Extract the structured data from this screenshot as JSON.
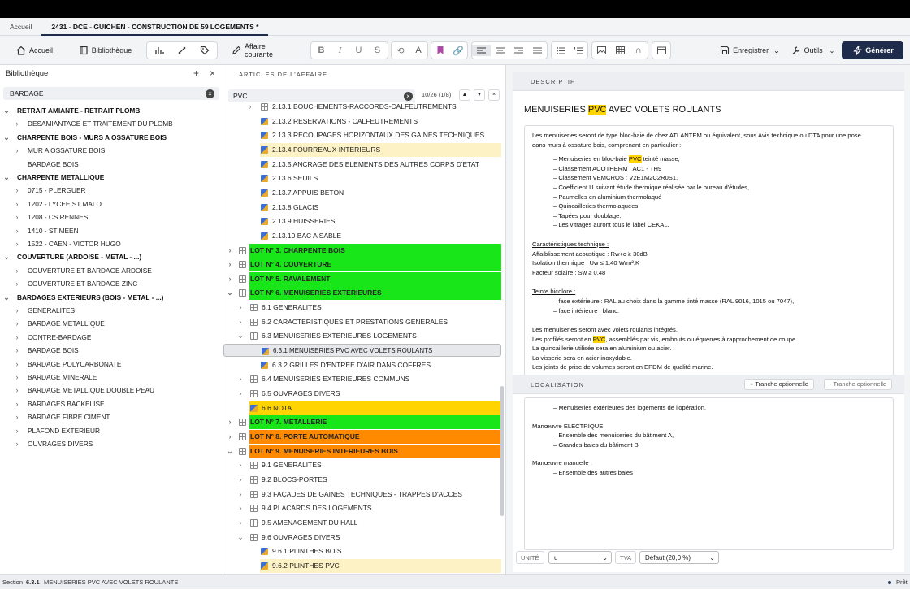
{
  "tabs": [
    {
      "label": "Accueil",
      "active": false
    },
    {
      "label": "2431 - DCE - GUICHEN - CONSTRUCTION DE 59 LOGEMENTS *",
      "active": true
    }
  ],
  "toolbar": {
    "home": "Accueil",
    "library": "Bibliothèque",
    "current_affair": "Affaire courante",
    "save": "Enregistrer",
    "tools": "Outils",
    "generate": "Générer"
  },
  "library": {
    "title": "Bibliothèque",
    "search_value": "BARDAGE",
    "items": [
      {
        "label": "RETRAIT AMIANTE - RETRAIT PLOMB",
        "level": 0,
        "chev": "v"
      },
      {
        "label": "DESAMIANTAGE ET TRAITEMENT DU PLOMB",
        "level": 1,
        "chev": ">"
      },
      {
        "label": "CHARPENTE BOIS - MURS A OSSATURE BOIS",
        "level": 0,
        "chev": "v"
      },
      {
        "label": "MUR A OSSATURE BOIS",
        "level": 1,
        "chev": ">"
      },
      {
        "label": "BARDAGE BOIS",
        "level": 1,
        "chev": ""
      },
      {
        "label": "CHARPENTE METALLIQUE",
        "level": 0,
        "chev": "v"
      },
      {
        "label": "0715 - PLERGUER",
        "level": 1,
        "chev": ">"
      },
      {
        "label": "1202 - LYCEE ST MALO",
        "level": 1,
        "chev": ">"
      },
      {
        "label": "1208 - CS RENNES",
        "level": 1,
        "chev": ">"
      },
      {
        "label": "1410 - ST MEEN",
        "level": 1,
        "chev": ">"
      },
      {
        "label": "1522 - CAEN - VICTOR HUGO",
        "level": 1,
        "chev": ">"
      },
      {
        "label": "COUVERTURE (ARDOISE - METAL - ...)",
        "level": 0,
        "chev": "v"
      },
      {
        "label": "COUVERTURE ET BARDAGE ARDOISE",
        "level": 1,
        "chev": ">"
      },
      {
        "label": "COUVERTURE ET BARDAGE ZINC",
        "level": 1,
        "chev": ">"
      },
      {
        "label": "BARDAGES EXTERIEURS (BOIS - METAL - ...)",
        "level": 0,
        "chev": "v"
      },
      {
        "label": "GENERALITES",
        "level": 1,
        "chev": ">"
      },
      {
        "label": "BARDAGE METALLIQUE",
        "level": 1,
        "chev": ">"
      },
      {
        "label": "CONTRE-BARDAGE",
        "level": 1,
        "chev": ">"
      },
      {
        "label": "BARDAGE BOIS",
        "level": 1,
        "chev": ">"
      },
      {
        "label": "BARDAGE POLYCARBONATE",
        "level": 1,
        "chev": ">"
      },
      {
        "label": "BARDAGE MINERALE",
        "level": 1,
        "chev": ">"
      },
      {
        "label": "BARDAGE METALLIQUE DOUBLE PEAU",
        "level": 1,
        "chev": ">"
      },
      {
        "label": "BARDAGES BACKELISE",
        "level": 1,
        "chev": ">"
      },
      {
        "label": "BARDAGE FIBRE CIMENT",
        "level": 1,
        "chev": ">"
      },
      {
        "label": "PLAFOND EXTERIEUR",
        "level": 1,
        "chev": ">"
      },
      {
        "label": "OUVRAGES DIVERS",
        "level": 1,
        "chev": ">"
      }
    ]
  },
  "articles": {
    "title": "ARTICLES DE L'AFFAIRE",
    "search_value": "PVC",
    "match_count": "10/26 (1/8)",
    "rows": [
      {
        "label": "2.13.1 BOUCHEMENTS-RACCORDS-CALFEUTREMENTS",
        "kind": "group",
        "chev": ">",
        "indent": 2,
        "style": ""
      },
      {
        "label": "2.13.2 RESERVATIONS - CALFEUTREMENTS",
        "kind": "doc",
        "chev": "",
        "indent": 3,
        "style": ""
      },
      {
        "label": "2.13.3 RECOUPAGES HORIZONTAUX DES GAINES TECHNIQUES",
        "kind": "doc",
        "chev": "",
        "indent": 3,
        "style": ""
      },
      {
        "label": "2.13.4 FOURREAUX INTERIEURS",
        "kind": "doc",
        "chev": "",
        "indent": 3,
        "style": "yellowlt"
      },
      {
        "label": "2.13.5 ANCRAGE DES ELEMENTS DES AUTRES CORPS D'ETAT",
        "kind": "doc",
        "chev": "",
        "indent": 3,
        "style": ""
      },
      {
        "label": "2.13.6 SEUILS",
        "kind": "doc",
        "chev": "",
        "indent": 3,
        "style": ""
      },
      {
        "label": "2.13.7 APPUIS BETON",
        "kind": "doc",
        "chev": "",
        "indent": 3,
        "style": ""
      },
      {
        "label": "2.13.8 GLACIS",
        "kind": "doc",
        "chev": "",
        "indent": 3,
        "style": ""
      },
      {
        "label": "2.13.9 HUISSERIES",
        "kind": "doc",
        "chev": "",
        "indent": 3,
        "style": ""
      },
      {
        "label": "2.13.10 BAC A SABLE",
        "kind": "doc",
        "chev": "",
        "indent": 3,
        "style": ""
      },
      {
        "label": "LOT N° 3. CHARPENTE BOIS",
        "kind": "group",
        "chev": ">",
        "indent": 0,
        "style": "green"
      },
      {
        "label": "LOT N° 4. COUVERTURE",
        "kind": "group",
        "chev": ">",
        "indent": 0,
        "style": "green"
      },
      {
        "label": "LOT N° 5. RAVALEMENT",
        "kind": "group",
        "chev": ">",
        "indent": 0,
        "style": "green"
      },
      {
        "label": "LOT N° 6. MENUISERIES EXTERIEURES",
        "kind": "group",
        "chev": "v",
        "indent": 0,
        "style": "green"
      },
      {
        "label": "6.1 GENERALITES",
        "kind": "group",
        "chev": ">",
        "indent": 1,
        "style": ""
      },
      {
        "label": "6.2 CARACTERISTIQUES ET PRESTATIONS GENERALES",
        "kind": "group",
        "chev": ">",
        "indent": 1,
        "style": ""
      },
      {
        "label": "6.3 MENUISERIES EXTERIEURES LOGEMENTS",
        "kind": "group",
        "chev": "v",
        "indent": 1,
        "style": ""
      },
      {
        "label": "6.3.1 MENUISERIES PVC AVEC VOLETS ROULANTS",
        "kind": "doc",
        "chev": "",
        "indent": 2,
        "style": "sel"
      },
      {
        "label": "6.3.2 GRILLES D'ENTREE D'AIR DANS COFFRES",
        "kind": "doc",
        "chev": "",
        "indent": 2,
        "style": ""
      },
      {
        "label": "6.4 MENUISERIES EXTERIEURES COMMUNS",
        "kind": "group",
        "chev": ">",
        "indent": 1,
        "style": ""
      },
      {
        "label": "6.5 OUVRAGES DIVERS",
        "kind": "group",
        "chev": ">",
        "indent": 1,
        "style": ""
      },
      {
        "label": "6.6 NOTA",
        "kind": "doc",
        "chev": "",
        "indent": 1,
        "style": "yellow"
      },
      {
        "label": "LOT N° 7. METALLERIE",
        "kind": "group",
        "chev": ">",
        "indent": 0,
        "style": "green"
      },
      {
        "label": "LOT N° 8. PORTE AUTOMATIQUE",
        "kind": "group",
        "chev": ">",
        "indent": 0,
        "style": "orange"
      },
      {
        "label": "LOT N° 9. MENUISERIES INTERIEURES BOIS",
        "kind": "group",
        "chev": "v",
        "indent": 0,
        "style": "orange"
      },
      {
        "label": "9.1 GENERALITES",
        "kind": "group",
        "chev": ">",
        "indent": 1,
        "style": ""
      },
      {
        "label": "9.2 BLOCS-PORTES",
        "kind": "group",
        "chev": ">",
        "indent": 1,
        "style": ""
      },
      {
        "label": "9.3 FAÇADES DE GAINES TECHNIQUES - TRAPPES D'ACCES",
        "kind": "group",
        "chev": ">",
        "indent": 1,
        "style": ""
      },
      {
        "label": "9.4 PLACARDS DES LOGEMENTS",
        "kind": "group",
        "chev": ">",
        "indent": 1,
        "style": ""
      },
      {
        "label": "9.5 AMENAGEMENT DU HALL",
        "kind": "group",
        "chev": ">",
        "indent": 1,
        "style": ""
      },
      {
        "label": "9.6 OUVRAGES DIVERS",
        "kind": "group",
        "chev": "v",
        "indent": 1,
        "style": ""
      },
      {
        "label": "9.6.1 PLINTHES BOIS",
        "kind": "doc",
        "chev": "",
        "indent": 2,
        "style": ""
      },
      {
        "label": "9.6.2 PLINTHES PVC",
        "kind": "doc",
        "chev": "",
        "indent": 2,
        "style": "yellowlt"
      }
    ]
  },
  "descriptif": {
    "header": "DESCRIPTIF",
    "title_before": "MENUISERIES ",
    "title_hl": "PVC",
    "title_after": " AVEC VOLETS ROULANTS",
    "intro_1": "Les menuiseries seront de type bloc-baie de chez ATLANTEM ou équivalent, sous Avis technique ou DTA pour une pose",
    "intro_2": "dans murs à ossature bois, comprenant en particulier :",
    "list1_a": "– Menuiseries en bloc-baie ",
    "list1_hl": "PVC",
    "list1_b": " teinté masse,",
    "list2": "– Classement ACOTHERM : AC1 - TH9",
    "list3": "– Classement VEMCROS : V2E1M2C2R0S1.",
    "list4": "– Coefficient U suivant étude thermique réalisée par le bureau d'études,",
    "list5": "– Paumelles en aluminium thermolaqué",
    "list6": "– Quincailleries thermolaquées",
    "list7": "– Tapées pour doublage.",
    "list8": "– Les vitrages auront tous le label CEKAL.",
    "tech_title": "Caractéristiques technique :",
    "tech1": "Affaiblissement acoustique : Rw+c ≥ 30dB",
    "tech2": "Isolation thermique : Uw ≤ 1.40 W/m².K",
    "tech3": "Facteur solaire : Sw ≥ 0.48",
    "color_title": "Teinte bicolore :",
    "color1": "– face extérieure : RAL au choix dans la gamme tinté masse (RAL 9016, 1015 ou 7047),",
    "color2": "– face intérieure : blanc.",
    "end1": "Les menuiseries seront avec volets roulants intégrés.",
    "end2_a": "Les profilés seront en ",
    "end2_hl": "PVC",
    "end2_b": ", assemblés par vis, embouts ou équerres à rapprochement de coupe.",
    "end3": "La quincaillerie utilisée sera en aluminium ou acier.",
    "end4": "La visserie sera en acier inoxydable.",
    "end5": "Les joints de prise de volumes seront en EPDM de qualité marine."
  },
  "localisation": {
    "header": "LOCALISATION",
    "add_tranche": "+ Tranche optionnelle",
    "remove_tranche": "- Tranche optionnelle",
    "line1": "– Menuiseries extérieures des logements de l'opération.",
    "elec_title": "Manœuvre ELECTRIQUE",
    "elec1": "– Ensemble des menuiseries du bâtiment A,",
    "elec2": "– Grandes baies du bâtiment B",
    "man_title": "Manœuvre manuelle :",
    "man1": "– Ensemble des autres baies"
  },
  "unit_row": {
    "unit_label": "UNITÉ",
    "unit_value": "u",
    "tva_label": "TVA",
    "tva_value": "Défaut (20,0 %)"
  },
  "footer": {
    "section_label": "Section",
    "section_number": "6.3.1",
    "section_title": "MENUISERIES PVC AVEC VOLETS ROULANTS",
    "status": "Prêt"
  }
}
